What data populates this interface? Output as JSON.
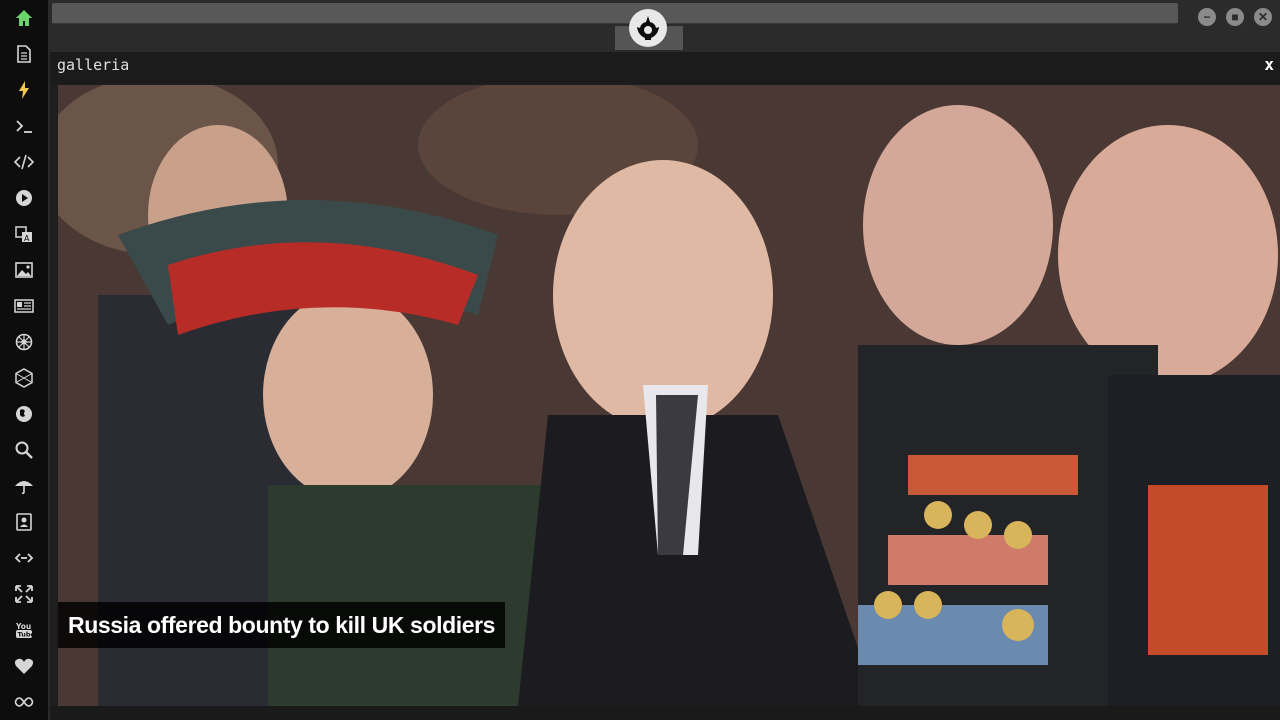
{
  "sidebar": {
    "items": [
      {
        "name": "home-icon",
        "color": "#6bd36b"
      },
      {
        "name": "document-icon"
      },
      {
        "name": "lightning-icon",
        "color": "#f2c94c"
      },
      {
        "name": "terminal-icon"
      },
      {
        "name": "code-icon"
      },
      {
        "name": "play-icon"
      },
      {
        "name": "translate-icon"
      },
      {
        "name": "image-icon"
      },
      {
        "name": "news-icon"
      },
      {
        "name": "settings-wheel-icon"
      },
      {
        "name": "hexagon-icon"
      },
      {
        "name": "globe-icon"
      },
      {
        "name": "search-icon"
      },
      {
        "name": "umbrella-icon"
      },
      {
        "name": "contact-card-icon"
      },
      {
        "name": "link-icon"
      },
      {
        "name": "expand-icon"
      },
      {
        "name": "youtube-icon"
      },
      {
        "name": "heart-icon"
      },
      {
        "name": "infinity-icon"
      }
    ]
  },
  "topbar": {
    "logo_icon": "rebel-alliance-icon",
    "buttons": [
      "minimize-icon",
      "maximize-icon",
      "close-icon"
    ],
    "button_labels": {
      "minimize": "−",
      "maximize": "■",
      "close": "✕"
    }
  },
  "panel": {
    "title": "galleria",
    "close_label": "x"
  },
  "gallery": {
    "caption": "Russia offered bounty to kill UK soldiers"
  }
}
